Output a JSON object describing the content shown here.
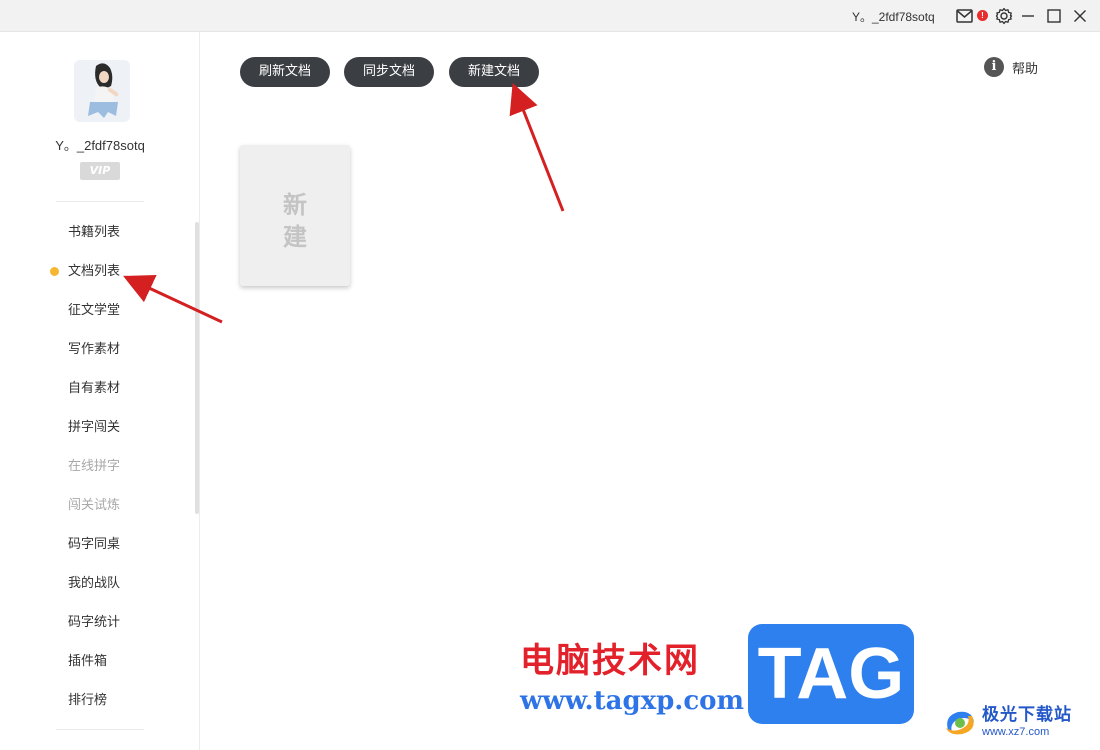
{
  "titlebar": {
    "username": "Y。_2fdf78sotq",
    "mail_badge": "!",
    "icons": [
      "mail-icon",
      "settings-gear-icon",
      "minimize-icon",
      "maximize-icon",
      "close-icon"
    ]
  },
  "sidebar": {
    "profile_name": "Y。_2fdf78sotq",
    "vip_label": "VIP",
    "menu": [
      {
        "label": "书籍列表",
        "active": false,
        "disabled": false
      },
      {
        "label": "文档列表",
        "active": true,
        "disabled": false
      },
      {
        "label": "征文学堂",
        "active": false,
        "disabled": false
      },
      {
        "label": "写作素材",
        "active": false,
        "disabled": false
      },
      {
        "label": "自有素材",
        "active": false,
        "disabled": false
      },
      {
        "label": "拼字闯关",
        "active": false,
        "disabled": false
      },
      {
        "label": "在线拼字",
        "active": false,
        "disabled": true
      },
      {
        "label": "闯关试炼",
        "active": false,
        "disabled": true
      },
      {
        "label": "码字同桌",
        "active": false,
        "disabled": false
      },
      {
        "label": "我的战队",
        "active": false,
        "disabled": false
      },
      {
        "label": "码字统计",
        "active": false,
        "disabled": false
      },
      {
        "label": "插件箱",
        "active": false,
        "disabled": false
      },
      {
        "label": "排行榜",
        "active": false,
        "disabled": false
      }
    ]
  },
  "toolbar": {
    "refresh_label": "刷新文档",
    "sync_label": "同步文档",
    "new_label": "新建文档",
    "help_label": "帮助",
    "help_icon_glyph": "i"
  },
  "card": {
    "line1": "新",
    "line2": "建"
  },
  "watermark": {
    "cn_text": "电脑技术网",
    "url": "www.tagxp.com",
    "tag": "TAG",
    "brand": "极光下载站",
    "brand_domain": "www.xz7.com"
  },
  "colors": {
    "accent_dot": "#f5b731",
    "pill_bg": "#3b3f44",
    "arrow": "#d42020"
  }
}
